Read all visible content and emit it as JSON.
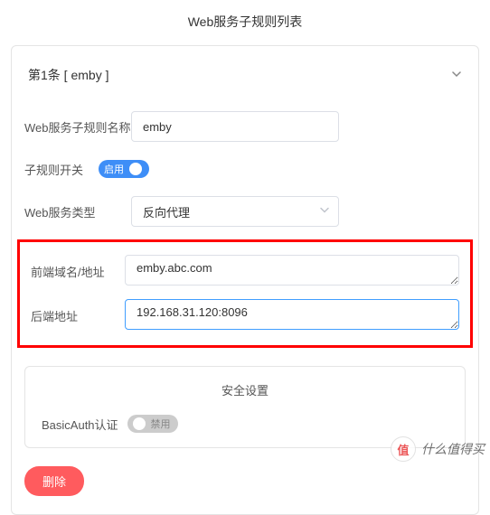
{
  "title": "Web服务子规则列表",
  "rule": {
    "header": "第1条 [ emby ]",
    "name_label": "Web服务子规则名称",
    "name_value": "emby",
    "switch_label": "子规则开关",
    "switch_state": "启用",
    "type_label": "Web服务类型",
    "type_value": "反向代理",
    "front_label": "前端域名/地址",
    "front_value": "emby.abc.com",
    "back_label": "后端地址",
    "back_value": "192.168.31.120:8096"
  },
  "security": {
    "title": "安全设置",
    "basicauth_label": "BasicAuth认证",
    "basicauth_state": "禁用"
  },
  "actions": {
    "delete": "删除"
  },
  "watermark": {
    "logo": "值",
    "text": "什么值得买"
  }
}
